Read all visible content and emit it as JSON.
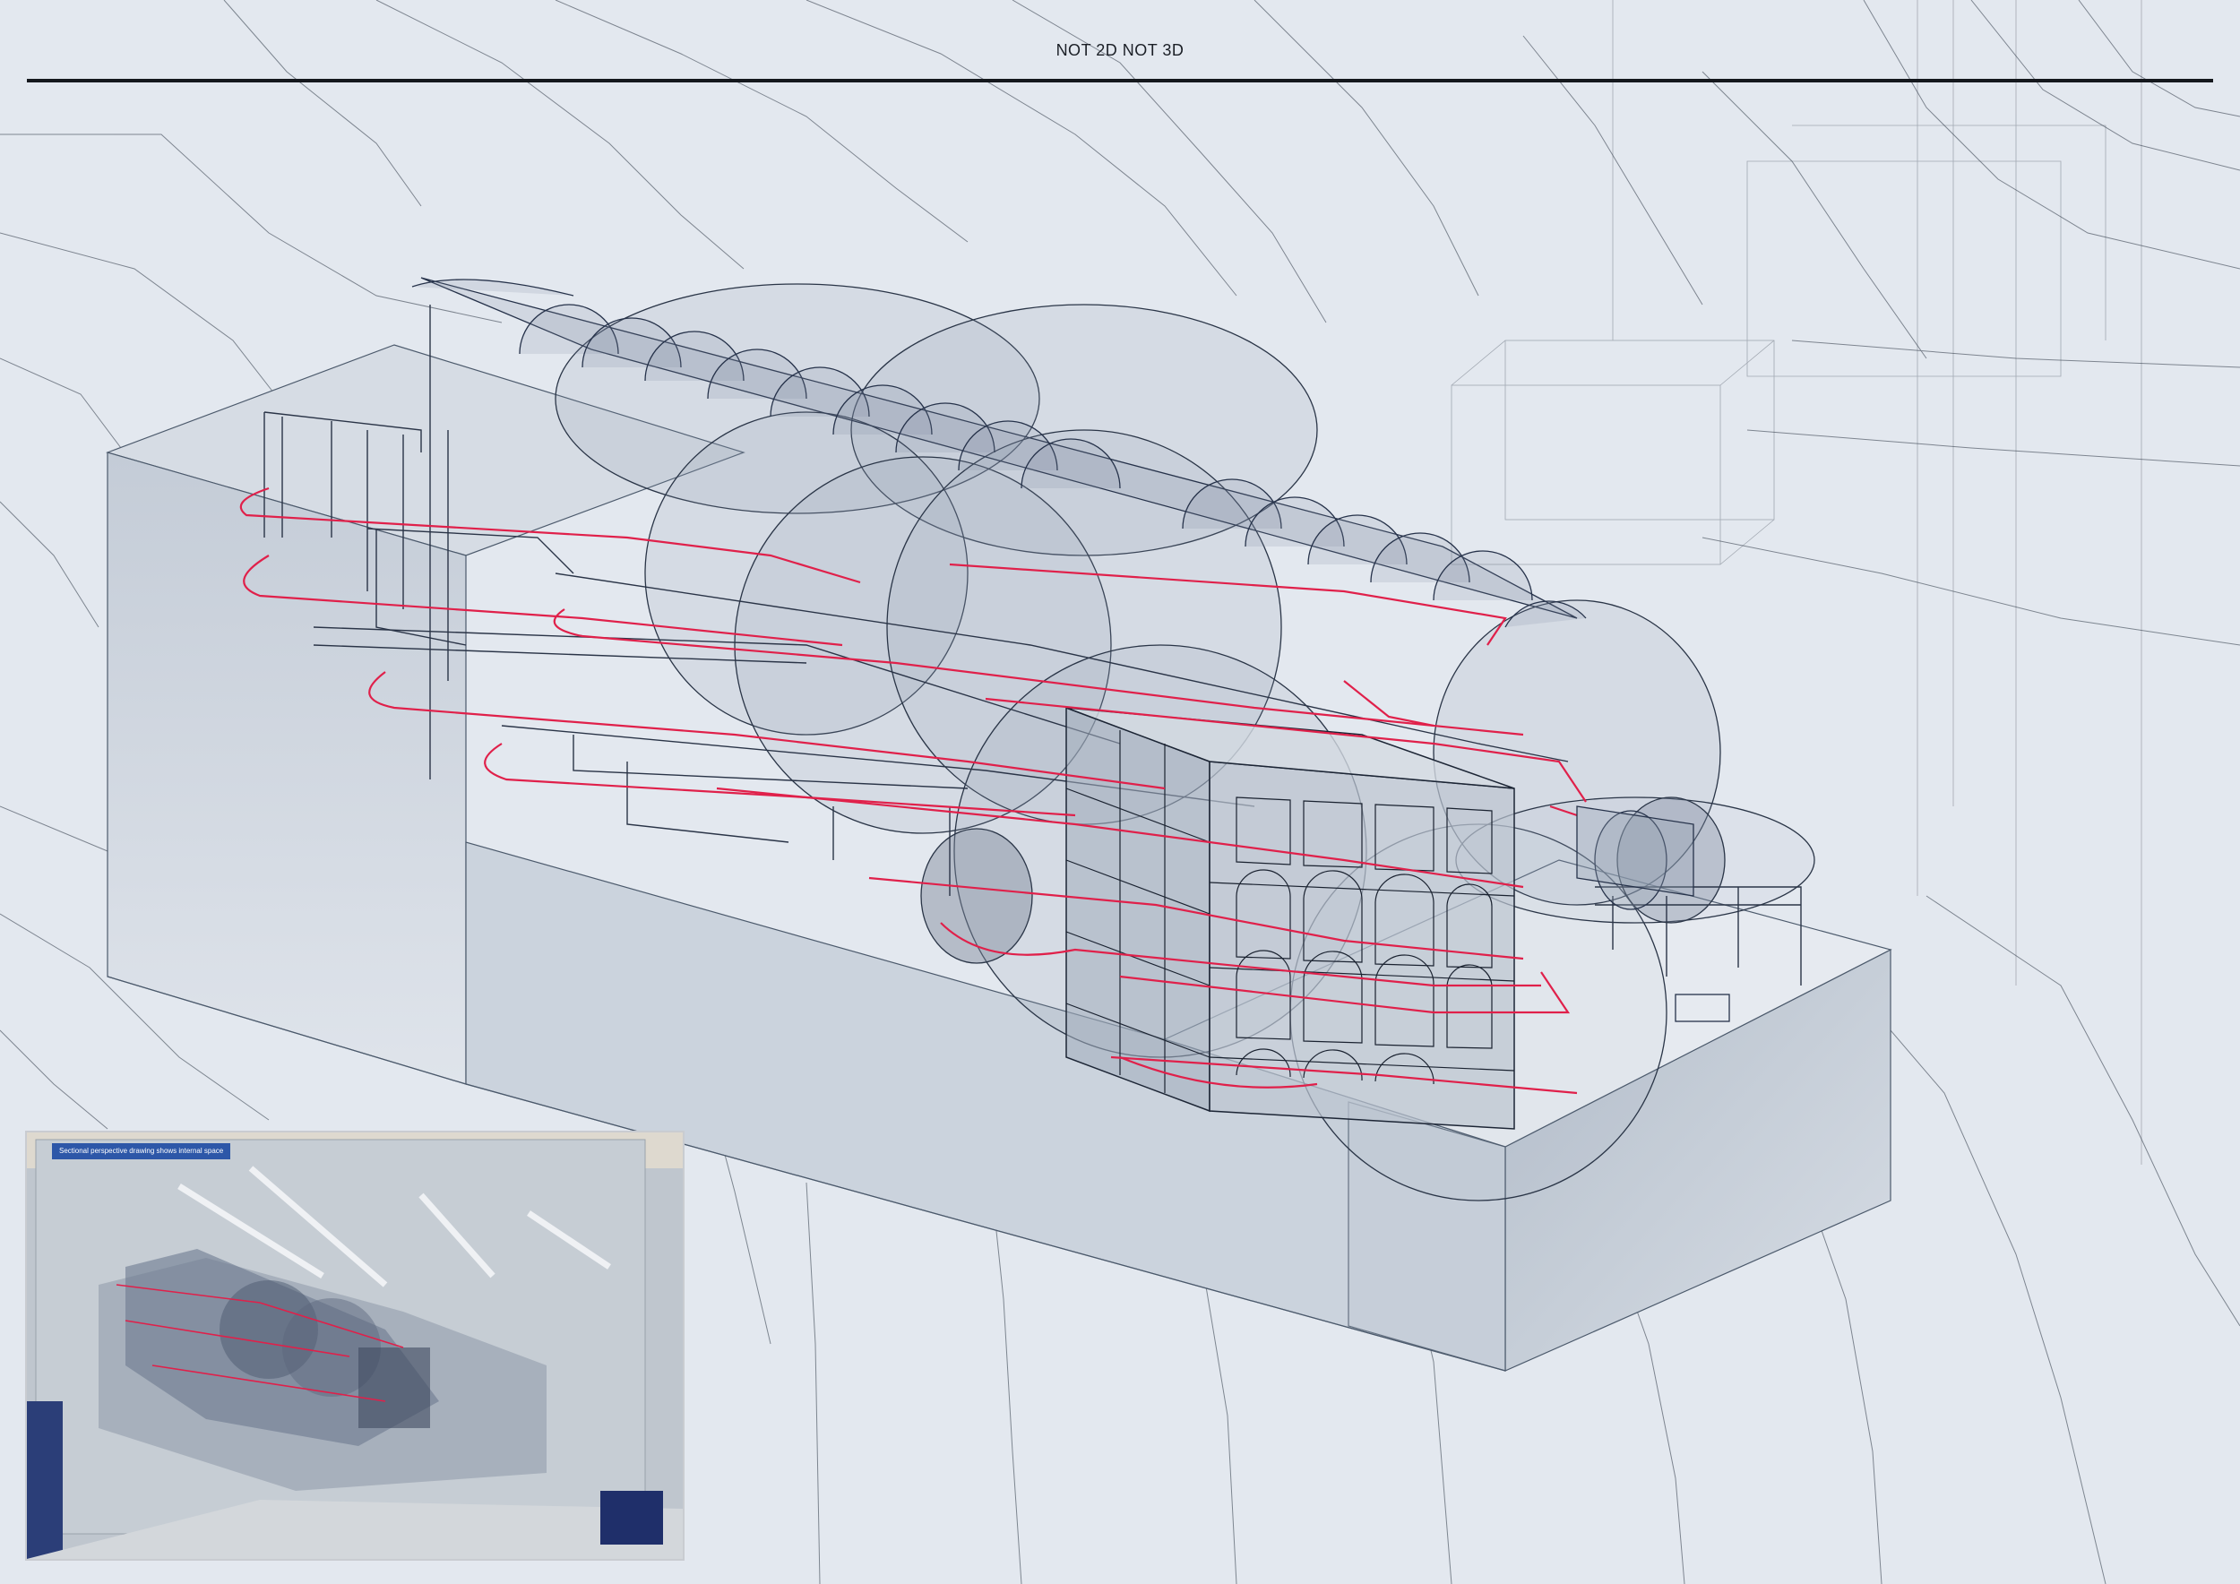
{
  "title": "NOT 2D NOT 3D",
  "inset_caption": "Sectional perspective drawing shows internal space",
  "colors": {
    "paper": "#e3e8ef",
    "linework": "#1f2a3a",
    "circulation": "#e0204a",
    "volume_fill": "#9aa6b5",
    "title_rule": "#15181d"
  }
}
